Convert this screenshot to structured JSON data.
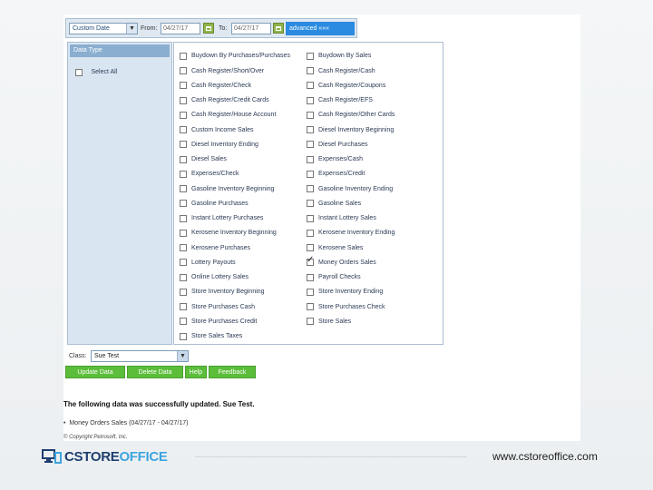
{
  "filter_bar": {
    "date_range_select": "Custom Date",
    "from_label": "From:",
    "from_value": "04/27/17",
    "to_label": "To:",
    "to_value": "04/27/17",
    "advanced_label": "advanced «««"
  },
  "data_type_panel": {
    "header": "Data Type",
    "select_all_label": "Select All"
  },
  "data_types": {
    "left": [
      {
        "label": "Buydown By Purchases/Purchases",
        "checked": false
      },
      {
        "label": "Cash Register/Short/Over",
        "checked": false
      },
      {
        "label": "Cash Register/Check",
        "checked": false
      },
      {
        "label": "Cash Register/Credit Cards",
        "checked": false
      },
      {
        "label": "Cash Register/House Account",
        "checked": false
      },
      {
        "label": "Custom Income Sales",
        "checked": false
      },
      {
        "label": "Diesel Inventory Ending",
        "checked": false
      },
      {
        "label": "Diesel Sales",
        "checked": false
      },
      {
        "label": "Expenses/Check",
        "checked": false
      },
      {
        "label": "Gasoline Inventory Beginning",
        "checked": false
      },
      {
        "label": "Gasoline Purchases",
        "checked": false
      },
      {
        "label": "Instant Lottery Purchases",
        "checked": false
      },
      {
        "label": "Kerosene Inventory Beginning",
        "checked": false
      },
      {
        "label": "Kerosene Purchases",
        "checked": false
      },
      {
        "label": "Lottery Payouts",
        "checked": false
      },
      {
        "label": "Online Lottery Sales",
        "checked": false
      },
      {
        "label": "Store Inventory Beginning",
        "checked": false
      },
      {
        "label": "Store Purchases Cash",
        "checked": false
      },
      {
        "label": "Store Purchases Credit",
        "checked": false
      },
      {
        "label": "Store Sales Taxes",
        "checked": false
      }
    ],
    "right": [
      {
        "label": "Buydown By Sales",
        "checked": false
      },
      {
        "label": "Cash Register/Cash",
        "checked": false
      },
      {
        "label": "Cash Register/Coupons",
        "checked": false
      },
      {
        "label": "Cash Register/EFS",
        "checked": false
      },
      {
        "label": "Cash Register/Other Cards",
        "checked": false
      },
      {
        "label": "Diesel Inventory Beginning",
        "checked": false
      },
      {
        "label": "Diesel Purchases",
        "checked": false
      },
      {
        "label": "Expenses/Cash",
        "checked": false
      },
      {
        "label": "Expenses/Credit",
        "checked": false
      },
      {
        "label": "Gasoline Inventory Ending",
        "checked": false
      },
      {
        "label": "Gasoline Sales",
        "checked": false
      },
      {
        "label": "Instant Lottery Sales",
        "checked": false
      },
      {
        "label": "Kerosene Inventory Ending",
        "checked": false
      },
      {
        "label": "Kerosene Sales",
        "checked": false
      },
      {
        "label": "Money Orders Sales",
        "checked": true
      },
      {
        "label": "Payroll Checks",
        "checked": false
      },
      {
        "label": "Store Inventory Ending",
        "checked": false
      },
      {
        "label": "Store Purchases Check",
        "checked": false
      },
      {
        "label": "Store Sales",
        "checked": false
      }
    ]
  },
  "class_row": {
    "label": "Class:",
    "value": "Sue Test"
  },
  "actions": {
    "update": "Update Data",
    "delete": "Delete Data",
    "help": "Help",
    "feedback": "Feedback"
  },
  "status_message": "The following data was successfully updated. Sue Test.",
  "summary_item": "Money Orders Sales (04/27/17 - 04/27/17)",
  "copyright": "© Copyright Petrosoft, Inc.",
  "footer": {
    "logo_part1": "CSTORE",
    "logo_part2": "OFFICE",
    "url": "www.cstoreoffice.com"
  },
  "colors": {
    "accent_blue": "#2b8be0",
    "action_green": "#5bbd3a",
    "panel_header": "#8aaed0",
    "logo_dark": "#1f3e6f",
    "logo_light": "#3ea4df"
  }
}
